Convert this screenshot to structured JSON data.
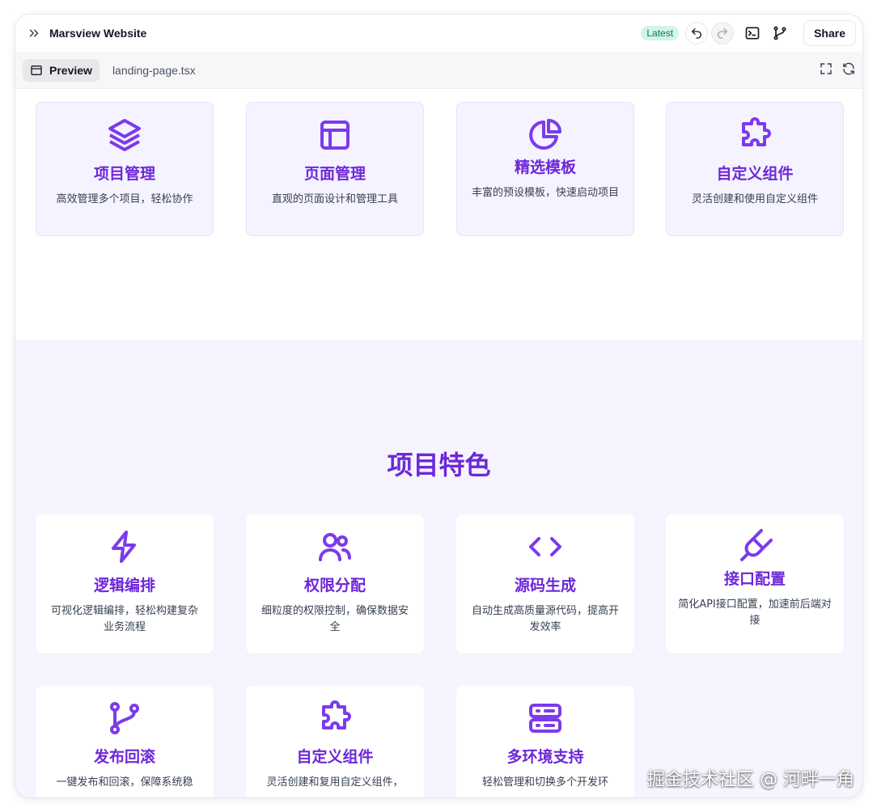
{
  "titlebar": {
    "title": "Marsview Website",
    "badge": "Latest",
    "share_label": "Share"
  },
  "tabs": {
    "preview_label": "Preview",
    "file_label": "landing-page.tsx"
  },
  "top_cards": [
    {
      "icon": "layers-icon",
      "title": "项目管理",
      "desc": "高效管理多个项目，轻松协作"
    },
    {
      "icon": "layout-icon",
      "title": "页面管理",
      "desc": "直观的页面设计和管理工具"
    },
    {
      "icon": "pie-chart-icon",
      "title": "精选模板",
      "desc": "丰富的预设模板，快速启动项目"
    },
    {
      "icon": "puzzle-icon",
      "title": "自定义组件",
      "desc": "灵活创建和使用自定义组件"
    }
  ],
  "features": {
    "heading": "项目特色",
    "cards": [
      {
        "icon": "bolt-icon",
        "title": "逻辑编排",
        "desc": "可视化逻辑编排，轻松构建复杂业务流程"
      },
      {
        "icon": "users-icon",
        "title": "权限分配",
        "desc": "细粒度的权限控制，确保数据安全"
      },
      {
        "icon": "code-icon",
        "title": "源码生成",
        "desc": "自动生成高质量源代码，提高开发效率"
      },
      {
        "icon": "plug-icon",
        "title": "接口配置",
        "desc": "简化API接口配置，加速前后端对接"
      },
      {
        "icon": "git-branch-icon",
        "title": "发布回滚",
        "desc": "一键发布和回滚，保障系统稳"
      },
      {
        "icon": "puzzle-icon",
        "title": "自定义组件",
        "desc": "灵活创建和复用自定义组件，"
      },
      {
        "icon": "server-icon",
        "title": "多环境支持",
        "desc": "轻松管理和切换多个开发环"
      }
    ]
  },
  "watermark": "掘金技术社区 @ 河畔一角",
  "colors": {
    "accent": "#6d28d9",
    "icon": "#7c3aed",
    "badge_bg": "#d1f5e8",
    "badge_text": "#047857",
    "features_bg": "#f6f4fe"
  }
}
